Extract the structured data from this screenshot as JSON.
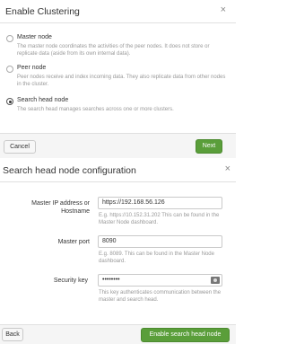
{
  "enable_clustering": {
    "title": "Enable Clustering",
    "close_glyph": "×",
    "options": [
      {
        "label": "Master node",
        "description": "The master node coordinates the activities of the peer nodes. It does not store or replicate data (aside from its own internal data).",
        "selected": false
      },
      {
        "label": "Peer node",
        "description": "Peer nodes receive and index incoming data. They also replicate data from other nodes in the cluster.",
        "selected": false
      },
      {
        "label": "Search head node",
        "description": "The search head manages searches across one or more clusters.",
        "selected": true
      }
    ],
    "cancel_label": "Cancel",
    "next_label": "Next"
  },
  "search_head_config": {
    "title": "Search head node configuration",
    "close_glyph": "×",
    "master_ip_label": "Master IP address or Hostname",
    "master_ip_value": "https://192.168.56.126",
    "master_ip_help": "E.g. https://10.152.31.202 This can be found in the Master Node dashboard.",
    "master_port_label": "Master port",
    "master_port_value": "8090",
    "master_port_help": "E.g. 8089. This can be found in the Master Node dashboard.",
    "security_key_label": "Security key",
    "security_key_value": "••••••••",
    "security_key_help": "This key authenticates communication between the master and search head.",
    "back_label": "Back",
    "submit_label": "Enable search head node"
  },
  "colors": {
    "primary_button": "#5a9e3a",
    "help_text": "#999999"
  }
}
